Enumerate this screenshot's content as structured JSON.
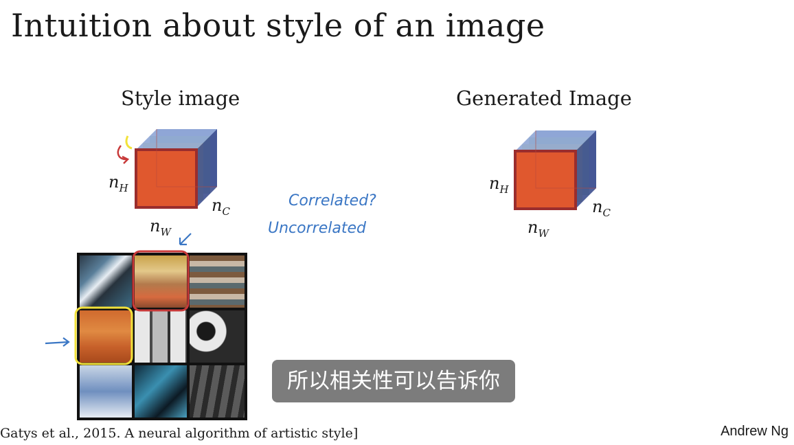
{
  "slide": {
    "title": "Intuition about style of an image",
    "citation": "Gatys et al., 2015. A neural algorithm of artistic style]",
    "author": "Andrew Ng"
  },
  "style_panel": {
    "caption": "Style image",
    "n_h": "n",
    "n_h_sub": "H",
    "n_c": "n",
    "n_c_sub": "C",
    "n_w": "n",
    "n_w_sub": "W"
  },
  "generated_panel": {
    "caption": "Generated Image",
    "n_h": "n",
    "n_h_sub": "H",
    "n_c": "n",
    "n_c_sub": "C",
    "n_w": "n",
    "n_w_sub": "W"
  },
  "annotations": {
    "correlated": "Correlated?",
    "uncorrelated": "Uncorrelated"
  },
  "subtitle": "所以相关性可以告诉你",
  "colors": {
    "red_channel": "#e0582e",
    "yellow_channel": "#e8e070",
    "green_channel": "#9ccc8e",
    "blue_channel": "#7f93c8",
    "ink_blue": "#3a76c4",
    "ink_red": "#c83a3a",
    "ink_yellow": "#f2e23a"
  }
}
